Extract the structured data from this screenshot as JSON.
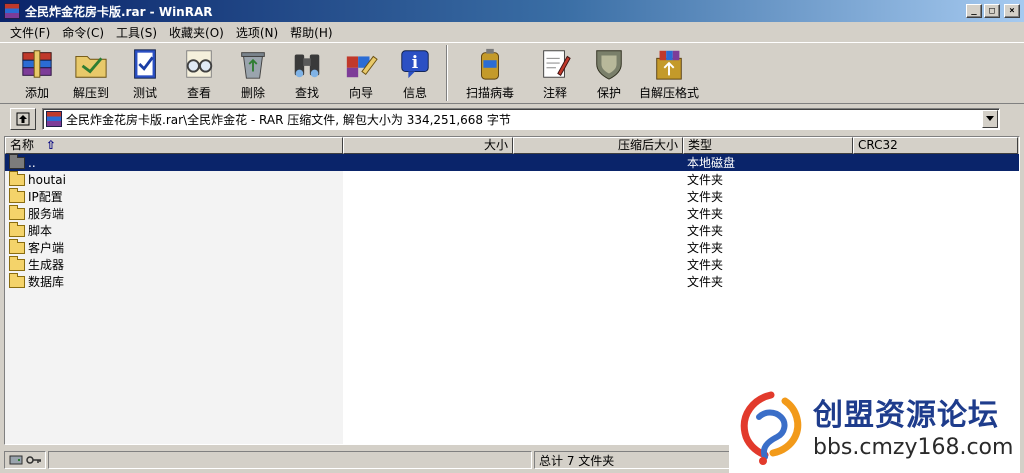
{
  "window": {
    "title": "全民炸金花房卡版.rar - WinRAR",
    "min_glyph": "_",
    "max_glyph": "□",
    "close_glyph": "×"
  },
  "menu": [
    "文件(F)",
    "命令(C)",
    "工具(S)",
    "收藏夹(O)",
    "选项(N)",
    "帮助(H)"
  ],
  "toolbar": {
    "add": "添加",
    "extract": "解压到",
    "test": "测试",
    "view": "查看",
    "delete": "删除",
    "find": "查找",
    "wizard": "向导",
    "info": "信息",
    "virus_scan": "扫描病毒",
    "comment": "注释",
    "protect": "保护",
    "sfx": "自解压格式"
  },
  "address": {
    "text": "全民炸金花房卡版.rar\\全民炸金花 - RAR 压缩文件, 解包大小为 334,251,668 字节"
  },
  "columns": {
    "name": "名称",
    "size": "大小",
    "packed": "压缩后大小",
    "type": "类型",
    "crc": "CRC32"
  },
  "rows": [
    {
      "name": "..",
      "type": "本地磁盘",
      "selected": true
    },
    {
      "name": "houtai",
      "type": "文件夹"
    },
    {
      "name": "IP配置",
      "type": "文件夹"
    },
    {
      "name": "服务端",
      "type": "文件夹"
    },
    {
      "name": "脚本",
      "type": "文件夹"
    },
    {
      "name": "客户端",
      "type": "文件夹"
    },
    {
      "name": "生成器",
      "type": "文件夹"
    },
    {
      "name": "数据库",
      "type": "文件夹"
    }
  ],
  "status": {
    "left": "",
    "right": "总计 7 文件夹"
  },
  "watermark": {
    "name": "创盟资源论坛",
    "url": "bbs.cmzy168.com"
  }
}
